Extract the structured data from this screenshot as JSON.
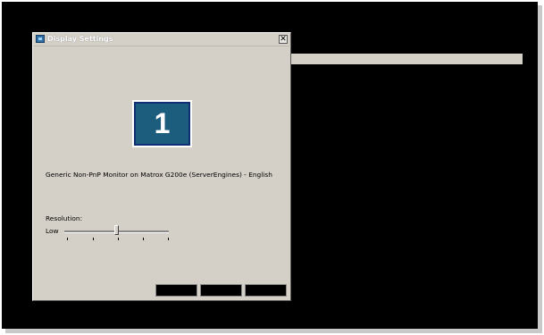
{
  "window": {
    "title": "Display Settings",
    "close_glyph": "✕",
    "icon": "display-icon"
  },
  "monitor": {
    "number": "1",
    "description": "Generic Non-PnP Monitor on Matrox G200e (ServerEngines) - English"
  },
  "resolution": {
    "label": "Resolution:",
    "low_label": "Low",
    "value_fraction": 0.5
  },
  "colors": {
    "desktop": "#000000",
    "window_face": "#d4d0c8",
    "monitor_fill": "#1c5d7e",
    "monitor_border": "#0f2f75"
  }
}
